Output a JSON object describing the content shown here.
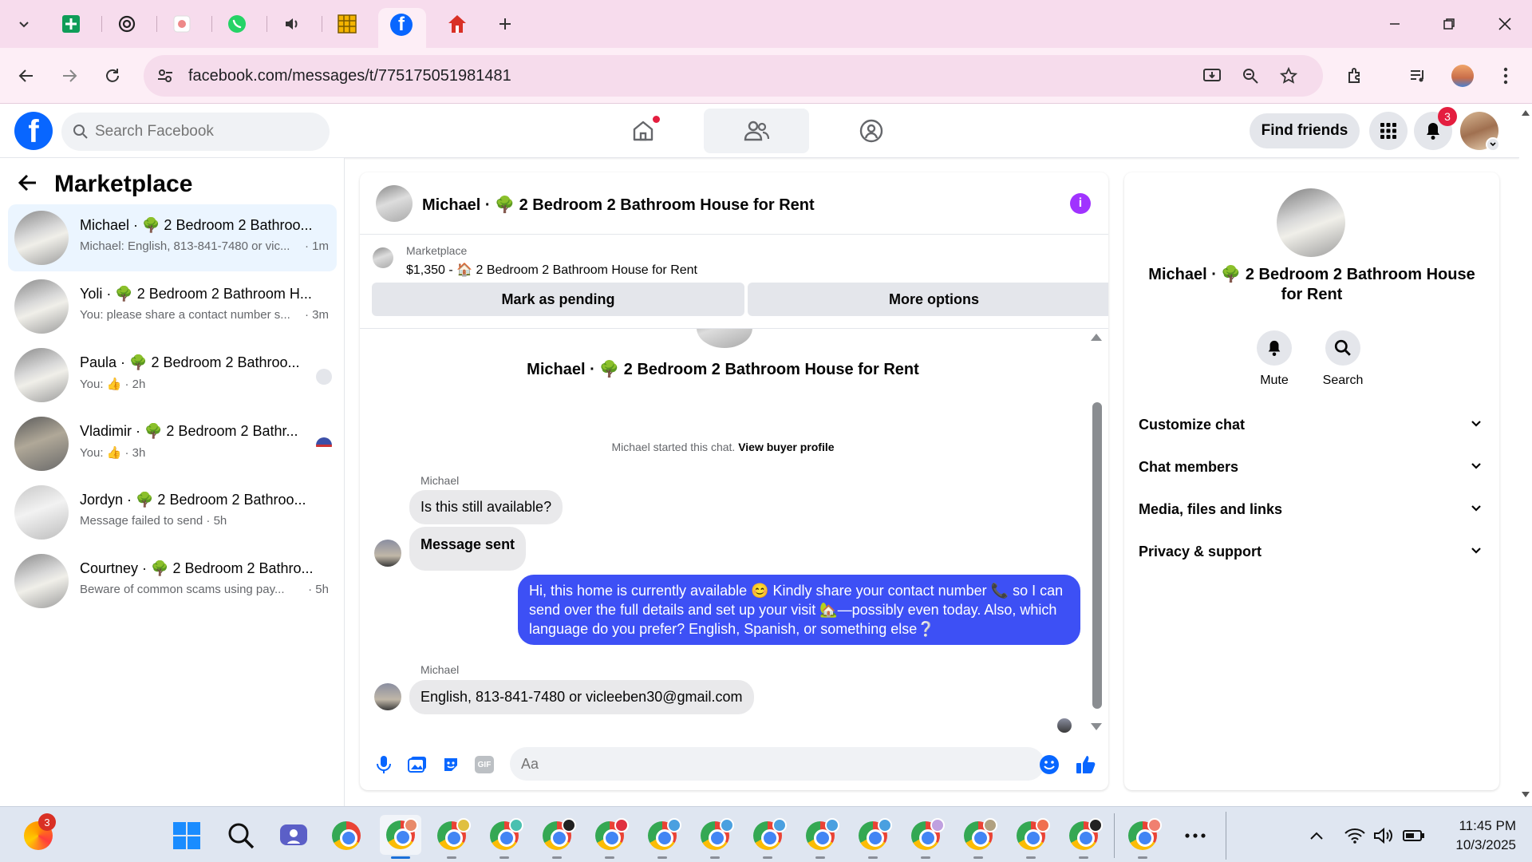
{
  "browser": {
    "url": "facebook.com/messages/t/775175051981481",
    "tabs": [
      "sheets",
      "chatgpt",
      "tab-3",
      "whatsapp",
      "audio",
      "sheet-grid",
      "facebook",
      "tab-red"
    ]
  },
  "header": {
    "search_placeholder": "Search Facebook",
    "find_friends": "Find friends",
    "notifications_count": "3"
  },
  "sidebar": {
    "title": "Marketplace",
    "conversations": [
      {
        "name": "Michael · 🌳 2 Bedroom 2 Bathroo...",
        "preview": "Michael: English, 813-841-7480 or vic...",
        "time": "· 1m"
      },
      {
        "name": "Yoli · 🌳 2 Bedroom 2 Bathroom H...",
        "preview": "You: please share a contact number s...",
        "time": "· 3m"
      },
      {
        "name": "Paula · 🌳 2 Bedroom 2 Bathroo...",
        "preview": "You: 👍 · 2h",
        "time": ""
      },
      {
        "name": "Vladimir · 🌳 2 Bedroom 2 Bathr...",
        "preview": "You: 👍 · 3h",
        "time": ""
      },
      {
        "name": "Jordyn · 🌳 2 Bedroom 2 Bathroo...",
        "preview": "Message failed to send · 5h",
        "time": ""
      },
      {
        "name": "Courtney · 🌳 2 Bedroom 2 Bathro...",
        "preview": "Beware of common scams using pay...",
        "time": "· 5h"
      }
    ]
  },
  "chat": {
    "title": "Michael · 🌳 2 Bedroom 2 Bathroom House for Rent",
    "listing_label": "Marketplace",
    "listing_price": "$1,350 - 🏠 2 Bedroom 2 Bathroom House for Rent",
    "mark_pending": "Mark as pending",
    "more_options": "More options",
    "thread_name": "Michael · 🌳 2 Bedroom 2 Bathroom House for Rent",
    "started_text": "Michael started this chat.",
    "view_buyer_profile": "View buyer profile",
    "sender_1": "Michael",
    "msg_1": "Is this still available?",
    "msg_2": "Message sent",
    "msg_out": "Hi, this home is currently available 😊 Kindly share your contact number 📞 so I can send over the full details and set up your visit 🏡—possibly even today. Also, which language do you prefer? English, Spanish, or something else❔",
    "sender_2": "Michael",
    "msg_3": "English, 813-841-7480 or vicleeben30@gmail.com",
    "input_placeholder": "Aa"
  },
  "details": {
    "name": "Michael · 🌳 2 Bedroom 2 Bathroom House for Rent",
    "mute": "Mute",
    "search": "Search",
    "sections": [
      "Customize chat",
      "Chat members",
      "Media, files and links",
      "Privacy & support"
    ]
  },
  "taskbar": {
    "time": "11:45 PM",
    "date": "10/3/2025",
    "firefox_badge": "3"
  },
  "colors": {
    "fb_blue": "#0866ff",
    "outgoing_bubble": "#3d50f5",
    "tab_strip": "#f7dced",
    "info_purple": "#a033ff"
  }
}
